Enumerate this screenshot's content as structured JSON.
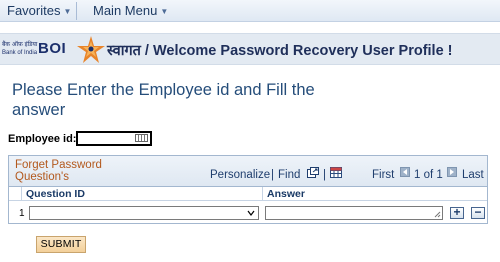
{
  "menubar": {
    "items": [
      {
        "label": "Favorites"
      },
      {
        "label": "Main Menu"
      }
    ]
  },
  "logo": {
    "hindi": "बैंक ऑफ़ इंडिया",
    "english": "Bank of India",
    "mark": "BOI"
  },
  "header": {
    "hindi": "स्वागत",
    "title": " / Welcome Password Recovery User Profile !"
  },
  "instruction": "Please Enter the Employee id and Fill the answer",
  "employee": {
    "label": "Employee id:",
    "value": ""
  },
  "grid": {
    "title": "Forget Password Question's",
    "personalize": "Personalize",
    "separator": "|",
    "find": "Find",
    "separator2": "|",
    "first": "First",
    "range": "1 of 1",
    "last": "Last",
    "columns": [
      "Question ID",
      "Answer"
    ],
    "rows": [
      {
        "num": "1",
        "question": "",
        "answer": ""
      }
    ],
    "add_label": "+",
    "delete_label": "−"
  },
  "submit_label": "SUBMIT",
  "colors": {
    "accent": "#254d7a",
    "header_bg": "#e3eaf2",
    "grid_title": "#b3591e",
    "submit_bg": "#f3d09a"
  }
}
